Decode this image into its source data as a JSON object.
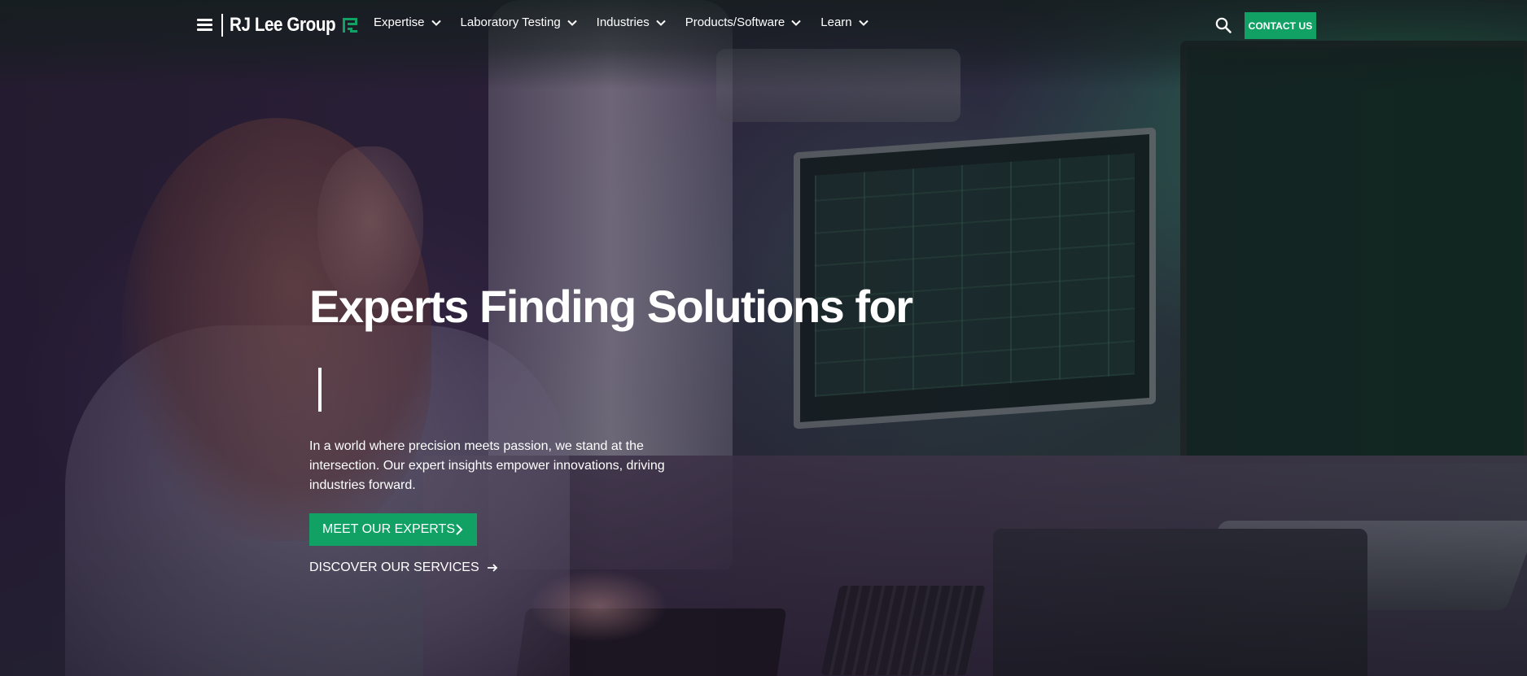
{
  "header": {
    "menu_icon": "hamburger-menu-icon",
    "logo_text": "RJ Lee Group",
    "logo_mark_icon": "rj-lee-logo-mark",
    "nav": [
      {
        "label": "Expertise"
      },
      {
        "label": "Laboratory Testing"
      },
      {
        "label": "Industries"
      },
      {
        "label": "Products/Software"
      },
      {
        "label": "Learn"
      }
    ],
    "search_icon": "search-icon",
    "contact_label": "CONTACT US"
  },
  "hero": {
    "title": "Experts Finding Solutions for",
    "description": "In a world where precision meets passion, we stand at the intersection. Our expert insights empower innovations, driving industries forward.",
    "primary_button_label": "MEET OUR EXPERTS",
    "secondary_link_label": "DISCOVER OUR SERVICES"
  },
  "colors": {
    "brand_green": "#12a164",
    "text": "#ffffff"
  }
}
